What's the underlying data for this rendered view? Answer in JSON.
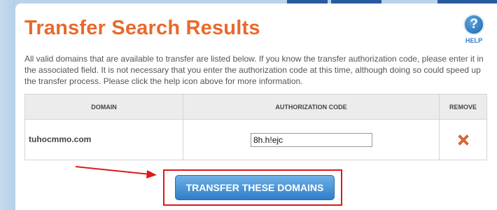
{
  "page": {
    "title": "Transfer Search Results",
    "intro": "All valid domains that are available to transfer are listed below. If you know the transfer authorization code, please enter it in the associated field. It is not necessary that you enter the authorization code at this time, although doing so could speed up the transfer process. Please click the help icon above for more information."
  },
  "help": {
    "glyph": "?",
    "label": "HELP",
    "icon": "help-question-icon"
  },
  "table": {
    "headers": [
      "DOMAIN",
      "AUTHORIZATION CODE",
      "REMOVE"
    ],
    "rows": [
      {
        "domain": "tuhocmmo.com",
        "auth_code": "8h.h!ejc",
        "remove_icon": "remove-x-icon"
      }
    ]
  },
  "actions": {
    "transfer_label": "TRANSFER THESE DOMAINS"
  },
  "colors": {
    "title": "#e9692c",
    "button": "#2f7ec9",
    "highlight": "#e01818",
    "remove_icon": "#e9692c"
  }
}
